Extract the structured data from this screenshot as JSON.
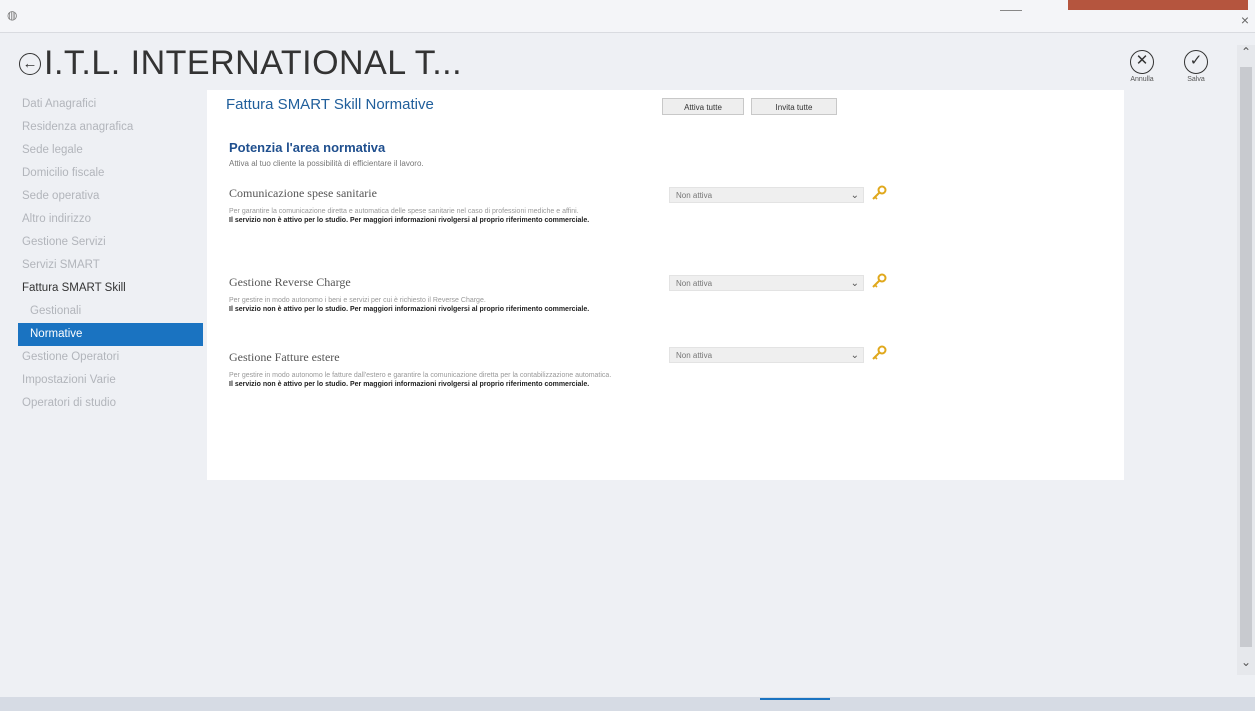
{
  "window": {
    "title": "I.T.L. INTERNATIONAL T...",
    "close_glyph": "×"
  },
  "actions": {
    "cancel_label": "Annulla",
    "save_label": "Salva"
  },
  "sidebar": {
    "items": [
      {
        "label": "Dati Anagrafici",
        "level": 0,
        "state": "disabled"
      },
      {
        "label": "Residenza anagrafica",
        "level": 0,
        "state": "disabled"
      },
      {
        "label": "Sede legale",
        "level": 0,
        "state": "disabled"
      },
      {
        "label": "Domicilio fiscale",
        "level": 0,
        "state": "disabled"
      },
      {
        "label": "Sede operativa",
        "level": 0,
        "state": "disabled"
      },
      {
        "label": "Altro indirizzo",
        "level": 0,
        "state": "disabled"
      },
      {
        "label": "Gestione Servizi",
        "level": 0,
        "state": "disabled"
      },
      {
        "label": "Servizi SMART",
        "level": 0,
        "state": "disabled"
      },
      {
        "label": "Fattura SMART Skill",
        "level": 0,
        "state": "normal"
      },
      {
        "label": "Gestionali",
        "level": 1,
        "state": "disabled"
      },
      {
        "label": "Normative",
        "level": 1,
        "state": "active"
      },
      {
        "label": "Gestione Operatori",
        "level": 0,
        "state": "disabled"
      },
      {
        "label": "Impostazioni Varie",
        "level": 0,
        "state": "disabled"
      },
      {
        "label": "Operatori di studio",
        "level": 0,
        "state": "disabled"
      }
    ]
  },
  "main": {
    "section_title": "Fattura SMART Skill Normative",
    "attiva_tutte_label": "Attiva tutte",
    "invita_tutte_label": "Invita tutte",
    "group_title": "Potenzia l'area normativa",
    "group_subtitle": "Attiva al tuo cliente la possibilità di efficientare il lavoro.",
    "services": [
      {
        "name": "Comunicazione spese sanitarie",
        "description": "Per garantire la comunicazione diretta e automatica delle spese sanitarie nel caso di professioni mediche e affini.",
        "warning": "Il servizio non è attivo per lo studio. Per maggiori informazioni rivolgersi al proprio riferimento commerciale.",
        "status": "Non attiva"
      },
      {
        "name": "Gestione Reverse Charge",
        "description": "Per gestire in modo autonomo i beni e servizi per cui è richiesto il Reverse Charge.",
        "warning": "Il servizio non è attivo per lo studio. Per maggiori informazioni rivolgersi al proprio riferimento commerciale.",
        "status": "Non attiva"
      },
      {
        "name": "Gestione Fatture estere",
        "description": "Per gestire in modo autonomo le fatture dall'estero e garantire la comunicazione diretta per la contabilizzazione automatica.",
        "warning": "Il servizio non è attivo per lo studio. Per maggiori informazioni rivolgersi al proprio riferimento commerciale.",
        "status": "Non attiva"
      }
    ]
  },
  "colors": {
    "accent": "#1a73c1",
    "title_blue": "#1f5e9b",
    "key_gold": "#e0a81c",
    "disabled_text": "#b2b5bb"
  },
  "icons": {
    "back": "back-arrow-icon",
    "cancel": "close-circle-icon",
    "save": "check-circle-icon",
    "key": "key-icon",
    "dropdown": "chevron-down-icon"
  }
}
